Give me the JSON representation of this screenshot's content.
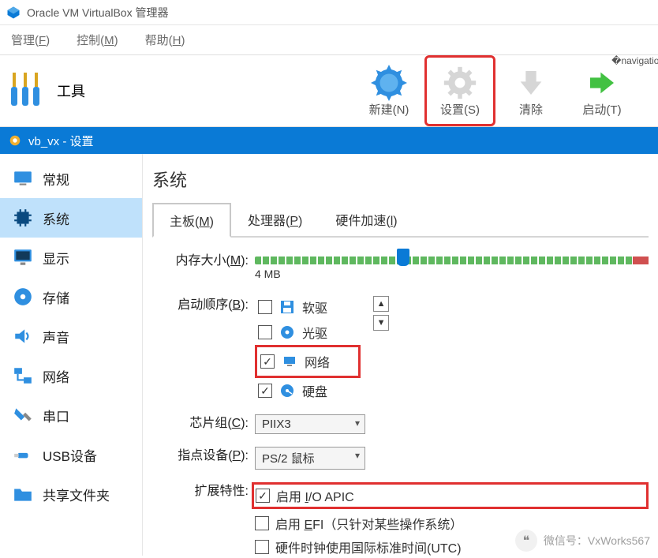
{
  "titlebar": {
    "title": "Oracle VM VirtualBox 管理器"
  },
  "menubar": {
    "file": "管理(F)",
    "file_u": "F",
    "control": "控制(M)",
    "control_u": "M",
    "help": "帮助(H)",
    "help_u": "H"
  },
  "tools_left": {
    "label": "工具"
  },
  "toolbar": {
    "new": "新建(N)",
    "settings": "设置(S)",
    "discard": "清除",
    "start": "启动(T)"
  },
  "settings_header": {
    "text": "vb_vx - 设置"
  },
  "sidebar": {
    "items": [
      {
        "label": "常规"
      },
      {
        "label": "系统"
      },
      {
        "label": "显示"
      },
      {
        "label": "存储"
      },
      {
        "label": "声音"
      },
      {
        "label": "网络"
      },
      {
        "label": "串口"
      },
      {
        "label": "USB设备"
      },
      {
        "label": "共享文件夹"
      }
    ]
  },
  "page": {
    "title": "系统"
  },
  "tabs": {
    "motherboard": "主板(M)",
    "motherboard_u": "M",
    "processor": "处理器(P)",
    "processor_u": "P",
    "accel": "硬件加速(l)",
    "accel_u": "l"
  },
  "memory": {
    "label": "内存大小(M):",
    "label_u": "M",
    "min": "4 MB"
  },
  "boot_order": {
    "label": "启动顺序(B):",
    "label_u": "B",
    "items": [
      {
        "label": "软驱",
        "checked": false
      },
      {
        "label": "光驱",
        "checked": false
      },
      {
        "label": "网络",
        "checked": true
      },
      {
        "label": "硬盘",
        "checked": true
      }
    ]
  },
  "chipset": {
    "label": "芯片组(C):",
    "label_u": "C",
    "value": "PIIX3"
  },
  "pointing": {
    "label": "指点设备(P):",
    "label_u": "P",
    "value": "PS/2 鼠标"
  },
  "extended": {
    "label": "扩展特性:",
    "ioapic": {
      "pre": "启用 ",
      "u": "I",
      "post": "/O APIC",
      "checked": true
    },
    "efi": {
      "pre": "启用 ",
      "u": "E",
      "post": "FI（只针对某些操作系统）",
      "checked": false
    },
    "utc": {
      "label": "硬件时钟使用国际标准时间(UTC)",
      "checked": false
    }
  },
  "watermark": {
    "text": "微信号：VxWorks567"
  }
}
